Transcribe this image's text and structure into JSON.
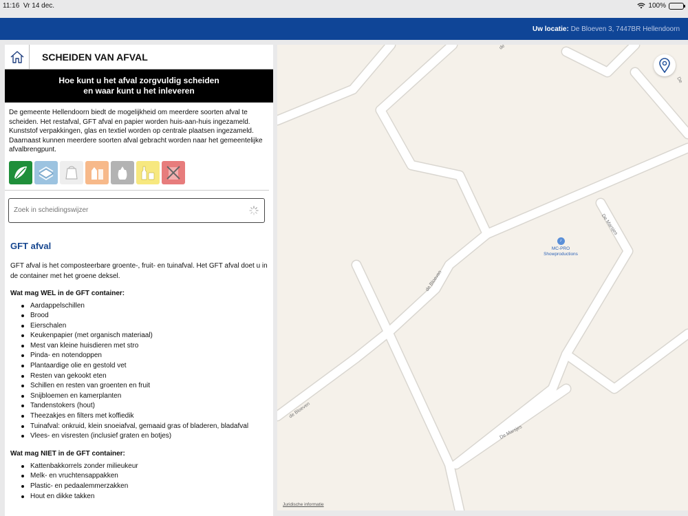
{
  "status": {
    "time": "11:16",
    "date": "Vr 14 dec.",
    "battery": "100%"
  },
  "topbar": {
    "location_label": "Uw locatie:",
    "location_value": "De Bloeven 3, 7447BR Hellendoorn",
    "color": "#0f4597"
  },
  "panel": {
    "title": "SCHEIDEN VAN AFVAL",
    "banner_line1": "Hoe kunt u het afval zorgvuldig scheiden",
    "banner_line2": "en waar kunt u het inleveren",
    "intro": "De gemeente Hellendoorn biedt de mogelijkheid om meerdere soorten afval te scheiden. Het restafval, GFT afval en papier worden huis-aan-huis ingezameld. Kunststof verpakkingen, glas en textiel worden op centrale plaatsen ingezameld. Daarnaast kunnen meerdere soorten afval gebracht worden naar het gemeentelijke afvalbrengpunt.",
    "waste_icons": [
      {
        "name": "gft-icon",
        "color": "#1f8f3a"
      },
      {
        "name": "paper-icon",
        "color": "#9cc3e0"
      },
      {
        "name": "plastic-icon",
        "color": "#eeeeee"
      },
      {
        "name": "drink-carton-icon",
        "color": "#f7b98a"
      },
      {
        "name": "rest-waste-icon",
        "color": "#b3b3b3"
      },
      {
        "name": "glass-icon",
        "color": "#f7e87f"
      },
      {
        "name": "no-waste-icon",
        "color": "#e77c7c"
      }
    ],
    "search_placeholder": "Zoek in scheidingswijzer",
    "section_title": "GFT afval",
    "section_desc": "GFT afval is het composteerbare groente-, fruit- en tuinafval. Het GFT afval doet u in de container met het groene deksel.",
    "wel_title": "Wat mag WEL in de GFT container:",
    "wel_items": [
      "Aardappelschillen",
      "Brood",
      "Eierschalen",
      "Keukenpapier (met organisch materiaal)",
      "Mest van kleine huisdieren met stro",
      "Pinda- en notendoppen",
      "Plantaardige olie en gestold vet",
      "Resten van gekookt eten",
      "Schillen en resten van groenten en fruit",
      "Snijbloemen en kamerplanten",
      "Tandenstokers (hout)",
      "Theezakjes en filters met koffiedik",
      "Tuinafval: onkruid, klein snoeiafval, gemaaid gras of bladeren, bladafval",
      "Vlees- en visresten (inclusief graten en botjes)"
    ],
    "niet_title": "Wat mag NIET in de GFT container:",
    "niet_items": [
      "Kattenbakkorrels zonder milieukeur",
      "Melk- en vruchtensappakken",
      "Plastic- en pedaalemmerzakken",
      "Hout en dikke takken"
    ]
  },
  "map": {
    "streets": [
      "de Bloeven",
      "De Marsjes",
      "de Bloeven",
      "De Marsjes",
      "De",
      "de"
    ],
    "poi_name_line1": "MC-PRO",
    "poi_name_line2": "Showproductions",
    "legal": "Juridische informatie"
  }
}
